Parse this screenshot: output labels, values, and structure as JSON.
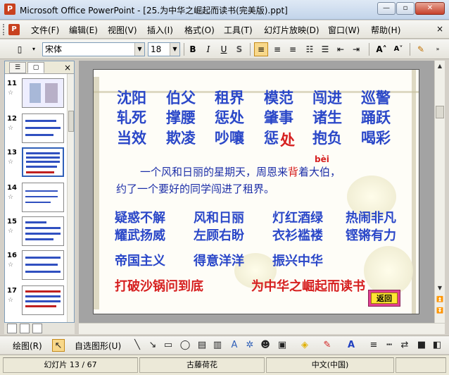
{
  "window": {
    "title": "Microsoft Office PowerPoint - [25.为中华之崛起而读书(完美版).ppt]",
    "app_icon": "P"
  },
  "menu": {
    "items": [
      "文件(F)",
      "编辑(E)",
      "视图(V)",
      "插入(I)",
      "格式(O)",
      "工具(T)",
      "幻灯片放映(D)",
      "窗口(W)",
      "帮助(H)"
    ],
    "close": "×"
  },
  "toolbar": {
    "font_name": "宋体",
    "font_size": "18",
    "bold": "B",
    "italic": "I",
    "underline": "U",
    "shadow": "S",
    "grow": "A˄",
    "shrink": "A˅"
  },
  "slides_pane": {
    "thumbs": [
      {
        "num": "11"
      },
      {
        "num": "12"
      },
      {
        "num": "13",
        "selected": true
      },
      {
        "num": "14"
      },
      {
        "num": "15"
      },
      {
        "num": "16"
      },
      {
        "num": "17"
      }
    ]
  },
  "slide": {
    "row1": [
      "沈阳",
      "伯父",
      "租界",
      "模范",
      "闯进",
      "巡警"
    ],
    "row2": [
      "轧死",
      "撑腰",
      "惩处",
      "肇事",
      "诸生",
      "踊跃"
    ],
    "row3": [
      "当效",
      "欺凌",
      "吵嚷",
      "惩",
      "处",
      "抱负",
      "喝彩"
    ],
    "pinyin": "bèi",
    "para_line1": "一个风和日丽的星期天，周恩来",
    "para_red": "背",
    "para_line1_end": "着大伯，",
    "para_line2": "约了一个要好的同学闯进了租界。",
    "idioms1": [
      "疑惑不解",
      "风和日丽",
      "灯红酒绿",
      "热闹非凡"
    ],
    "idioms2": [
      "耀武扬威",
      "左顾右盼",
      "衣衫褴褛",
      "铿锵有力"
    ],
    "idioms3": [
      "帝国主义",
      "得意洋洋",
      "振兴中华"
    ],
    "red1": "打破沙锅问到底",
    "red2": "为中华之崛起而读书",
    "back_button": "返回"
  },
  "drawbar": {
    "draw": "绘图(R)",
    "autoshapes": "自选图形(U)"
  },
  "status": {
    "slide_info": "幻灯片 13 / 67",
    "design": "古藤荷花",
    "language": "中文(中国)"
  }
}
